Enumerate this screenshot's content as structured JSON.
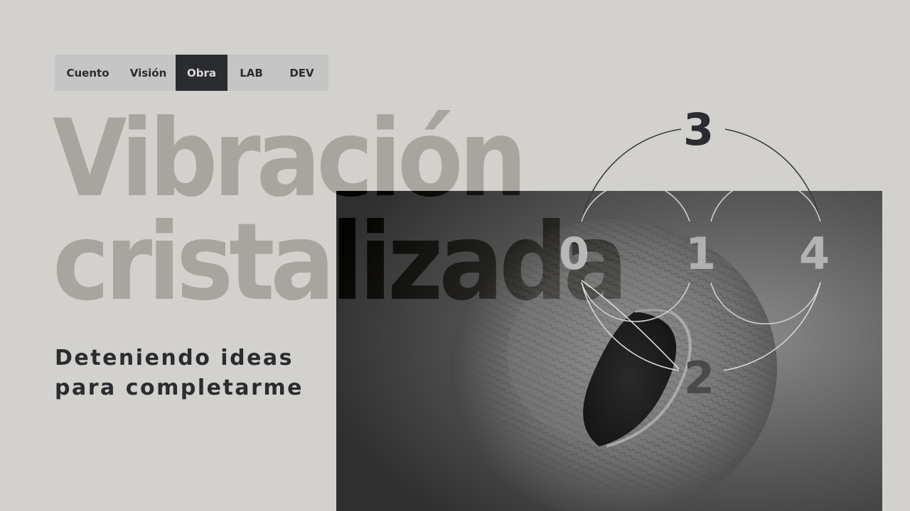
{
  "nav": {
    "items": [
      {
        "label": "Cuento"
      },
      {
        "label": "Visión"
      },
      {
        "label": "Obra",
        "active": true
      },
      {
        "label": "LAB"
      },
      {
        "label": "DEV"
      }
    ],
    "active_color": "#2b2c30",
    "background": "#c5c5c5"
  },
  "hero": {
    "title_line1": "Vibración",
    "title_line2": "cristalizada",
    "subtitle_line1": "Deteniendo ideas",
    "subtitle_line2": "para completarme"
  },
  "diagram": {
    "numbers": [
      "3",
      "0",
      "1",
      "4",
      "2"
    ]
  },
  "photo": {
    "subject": "ceramic-shell-sculpture"
  },
  "colors": {
    "background": "#d2d1cd",
    "text": "#2b2c30"
  }
}
